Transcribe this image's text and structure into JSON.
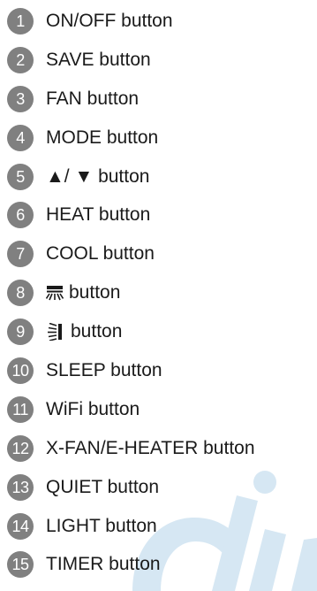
{
  "colors": {
    "badge": "#808080",
    "badge_text": "#ffffff",
    "text": "#1a1a1a",
    "watermark": "#cfe3f1"
  },
  "items": [
    {
      "number": "1",
      "label": "ON/OFF button"
    },
    {
      "number": "2",
      "label": "SAVE button"
    },
    {
      "number": "3",
      "label": "FAN button"
    },
    {
      "number": "4",
      "label": "MODE button"
    },
    {
      "number": "5",
      "label": "▲/ ▼ button"
    },
    {
      "number": "6",
      "label": "HEAT button"
    },
    {
      "number": "7",
      "label": "COOL button"
    },
    {
      "number": "8",
      "icon": "swing-louver-icon",
      "label": "button"
    },
    {
      "number": "9",
      "icon": "airflow-direction-icon",
      "label": "button"
    },
    {
      "number": "10",
      "label": "SLEEP button"
    },
    {
      "number": "11",
      "label": "WiFi button"
    },
    {
      "number": "12",
      "label": "X-FAN/E-HEATER button"
    },
    {
      "number": "13",
      "label": "QUIET button"
    },
    {
      "number": "14",
      "label": "LIGHT button"
    },
    {
      "number": "15",
      "label": "TIMER button"
    }
  ]
}
